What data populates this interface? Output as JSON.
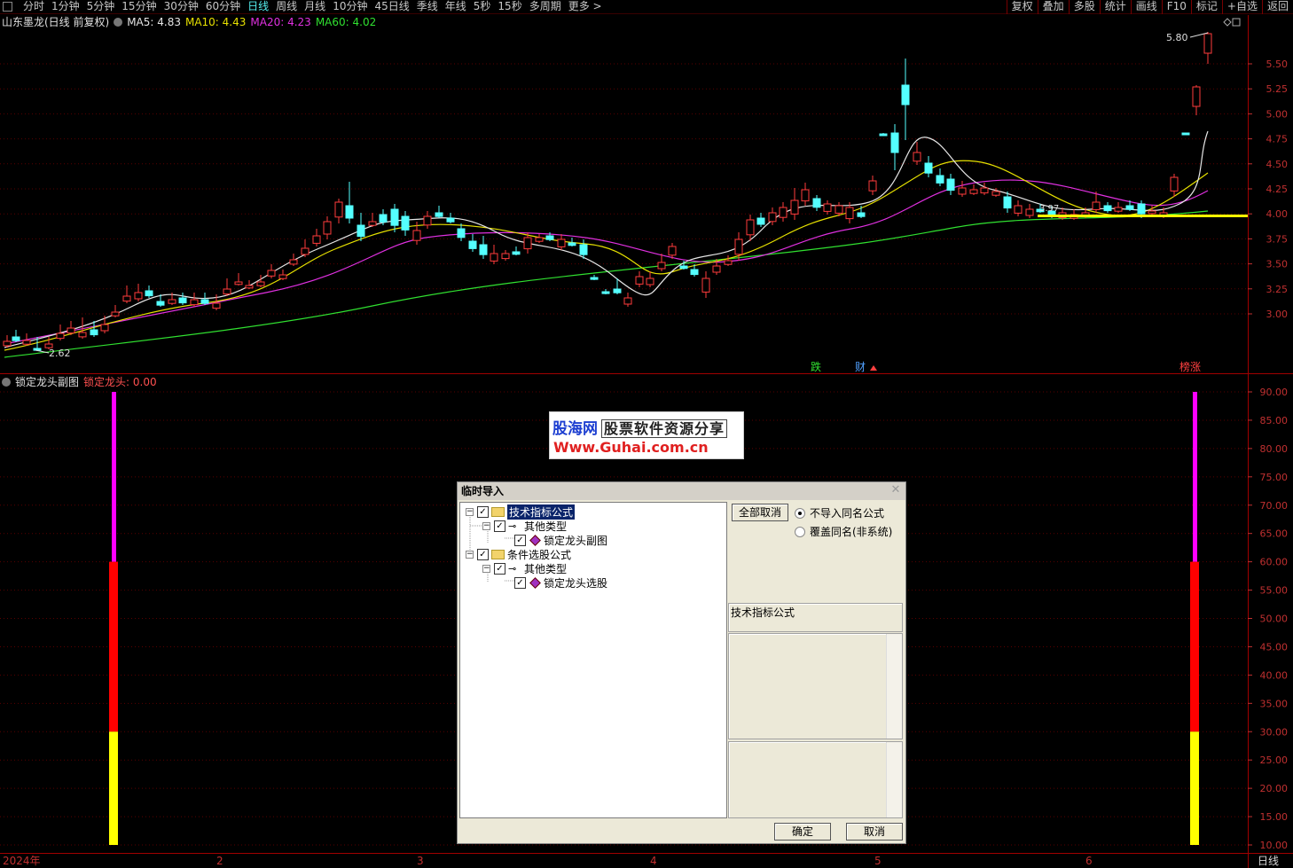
{
  "toolbar": {
    "periods": [
      "分时",
      "1分钟",
      "5分钟",
      "15分钟",
      "30分钟",
      "60分钟",
      "日线",
      "周线",
      "月线",
      "10分钟",
      "45日线",
      "季线",
      "年线",
      "5秒",
      "15秒",
      "多周期",
      "更多 >"
    ],
    "active_period": "日线",
    "right_buttons": [
      "复权",
      "叠加",
      "多股",
      "统计",
      "画线",
      "F10",
      "标记",
      "+自选",
      "返回"
    ]
  },
  "main_chart": {
    "title": "山东墨龙(日线 前复权)",
    "ma_labels": [
      {
        "text": "MA5: 4.83",
        "color": "#e6e6e6"
      },
      {
        "text": "MA10: 4.43",
        "color": "#e6e000"
      },
      {
        "text": "MA20: 4.23",
        "color": "#e030e0"
      },
      {
        "text": "MA60: 4.02",
        "color": "#30e030"
      }
    ],
    "price_ticks": [
      "5.50",
      "5.25",
      "5.00",
      "4.75",
      "4.50",
      "4.25",
      "4.00",
      "3.75",
      "3.50",
      "3.25",
      "3.00"
    ],
    "high_label": "5.80",
    "low_label": "2.62",
    "mid_label": "3.97",
    "markers": [
      {
        "text": "跌",
        "color": "#30e030"
      },
      {
        "text": "财",
        "color": "#50a0ff"
      },
      {
        "text": "榜涨",
        "color": "#ff4040"
      }
    ]
  },
  "sub_chart": {
    "title": "锁定龙头副图",
    "value_label": "锁定龙头: 0.00",
    "value_ticks": [
      "90.00",
      "85.00",
      "80.00",
      "75.00",
      "70.00",
      "65.00",
      "60.00",
      "55.00",
      "50.00",
      "45.00",
      "40.00",
      "35.00",
      "30.00",
      "25.00",
      "20.00",
      "15.00",
      "10.00"
    ]
  },
  "x_axis": {
    "labels": [
      "2024年",
      "2",
      "3",
      "4",
      "5",
      "6"
    ],
    "period_label": "日线"
  },
  "watermark": {
    "brand": "股海网",
    "slogan": "股票软件资源分享",
    "url": "Www.Guhai.com.cn"
  },
  "dialog": {
    "title": "临时导入",
    "tree": {
      "group1": "技术指标公式",
      "group1_type": "其他类型",
      "group1_item": "锁定龙头副图",
      "group2": "条件选股公式",
      "group2_type": "其他类型",
      "group2_item": "锁定龙头选股"
    },
    "cancel_all_button": "全部取消",
    "option_no_import": "不导入同名公式",
    "option_overwrite": "覆盖同名(非系统)",
    "info_label": "技术指标公式",
    "ok_button": "确定",
    "cancel_button": "取消"
  }
}
